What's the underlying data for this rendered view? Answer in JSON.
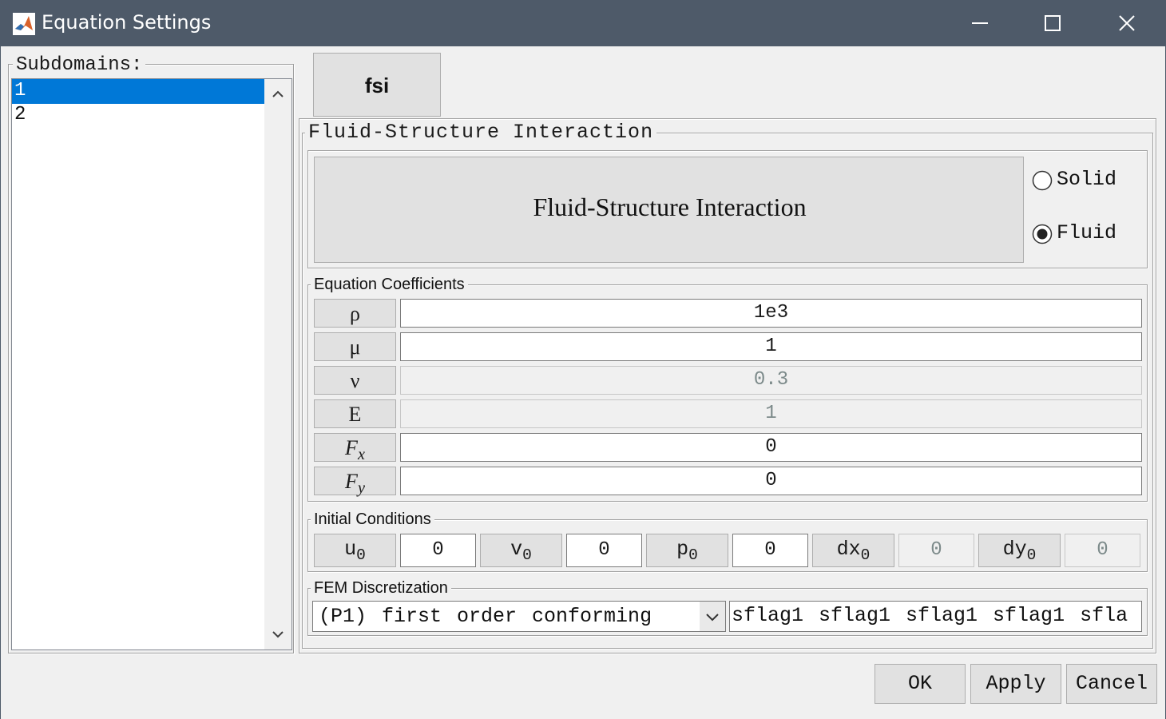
{
  "window": {
    "title": "Equation Settings"
  },
  "subdomains": {
    "legend": "Subdomains:",
    "items": [
      "1",
      "2"
    ],
    "selected_index": 0
  },
  "tab": {
    "label": "fsi"
  },
  "physics": {
    "legend": "Fluid-Structure Interaction",
    "banner": "Fluid-Structure Interaction",
    "radio_options": [
      "Solid",
      "Fluid"
    ],
    "selected_radio": "Fluid"
  },
  "coefficients": {
    "legend": "Equation Coefficients",
    "rows": [
      {
        "symbol": "ρ",
        "sub": "",
        "italic": false,
        "value": "1e3",
        "enabled": true
      },
      {
        "symbol": "μ",
        "sub": "",
        "italic": false,
        "value": "1",
        "enabled": true
      },
      {
        "symbol": "ν",
        "sub": "",
        "italic": false,
        "value": "0.3",
        "enabled": false
      },
      {
        "symbol": "E",
        "sub": "",
        "italic": false,
        "value": "1",
        "enabled": false
      },
      {
        "symbol": "F",
        "sub": "x",
        "italic": true,
        "value": "0",
        "enabled": true
      },
      {
        "symbol": "F",
        "sub": "y",
        "italic": true,
        "value": "0",
        "enabled": true
      }
    ]
  },
  "initial_conditions": {
    "legend": "Initial Conditions",
    "items": [
      {
        "symbol": "u",
        "sub": "0",
        "value": "0",
        "enabled": true
      },
      {
        "symbol": "v",
        "sub": "0",
        "value": "0",
        "enabled": true
      },
      {
        "symbol": "p",
        "sub": "0",
        "value": "0",
        "enabled": true
      },
      {
        "symbol": "dx",
        "sub": "0",
        "value": "0",
        "enabled": false
      },
      {
        "symbol": "dy",
        "sub": "0",
        "value": "0",
        "enabled": false
      }
    ]
  },
  "fem": {
    "legend": "FEM Discretization",
    "selected": "(P1) first order conforming",
    "flags": "sflag1 sflag1 sflag1 sflag1 sfla"
  },
  "buttons": {
    "ok": "OK",
    "apply": "Apply",
    "cancel": "Cancel"
  },
  "colors": {
    "titlebar": "#4e5a69",
    "selection": "#0078d7",
    "background": "#f0f0f0"
  }
}
